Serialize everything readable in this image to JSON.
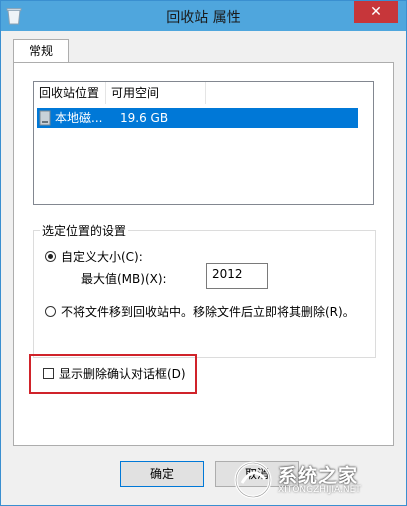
{
  "window": {
    "title": "回收站 属性",
    "close_glyph": "✕"
  },
  "tabs": [
    {
      "label": "常规",
      "selected": true
    }
  ],
  "locations_list": {
    "columns": [
      "回收站位置",
      "可用空间"
    ],
    "rows": [
      {
        "location": "本地磁...",
        "free_space": "19.6 GB",
        "selected": true
      }
    ]
  },
  "settings_group": {
    "legend": "选定位置的设置",
    "custom_size": {
      "label": "自定义大小(C):",
      "checked": true,
      "max_label": "最大值(MB)(X):",
      "max_value": "2012"
    },
    "no_recycle": {
      "label": "不将文件移到回收站中。移除文件后立即将其删除(R)。",
      "checked": false
    }
  },
  "confirm_checkbox": {
    "label": "显示删除确认对话框(D)",
    "checked": false
  },
  "buttons": {
    "ok": "确定",
    "cancel": "取消"
  },
  "watermark": {
    "text": "系统之家",
    "sub": "XITONGZHIJIA.NET"
  },
  "colors": {
    "highlight_border": "#d0232a",
    "selection": "#0078d7",
    "titlebar": "#4fa6dd",
    "close": "#c7363a"
  }
}
